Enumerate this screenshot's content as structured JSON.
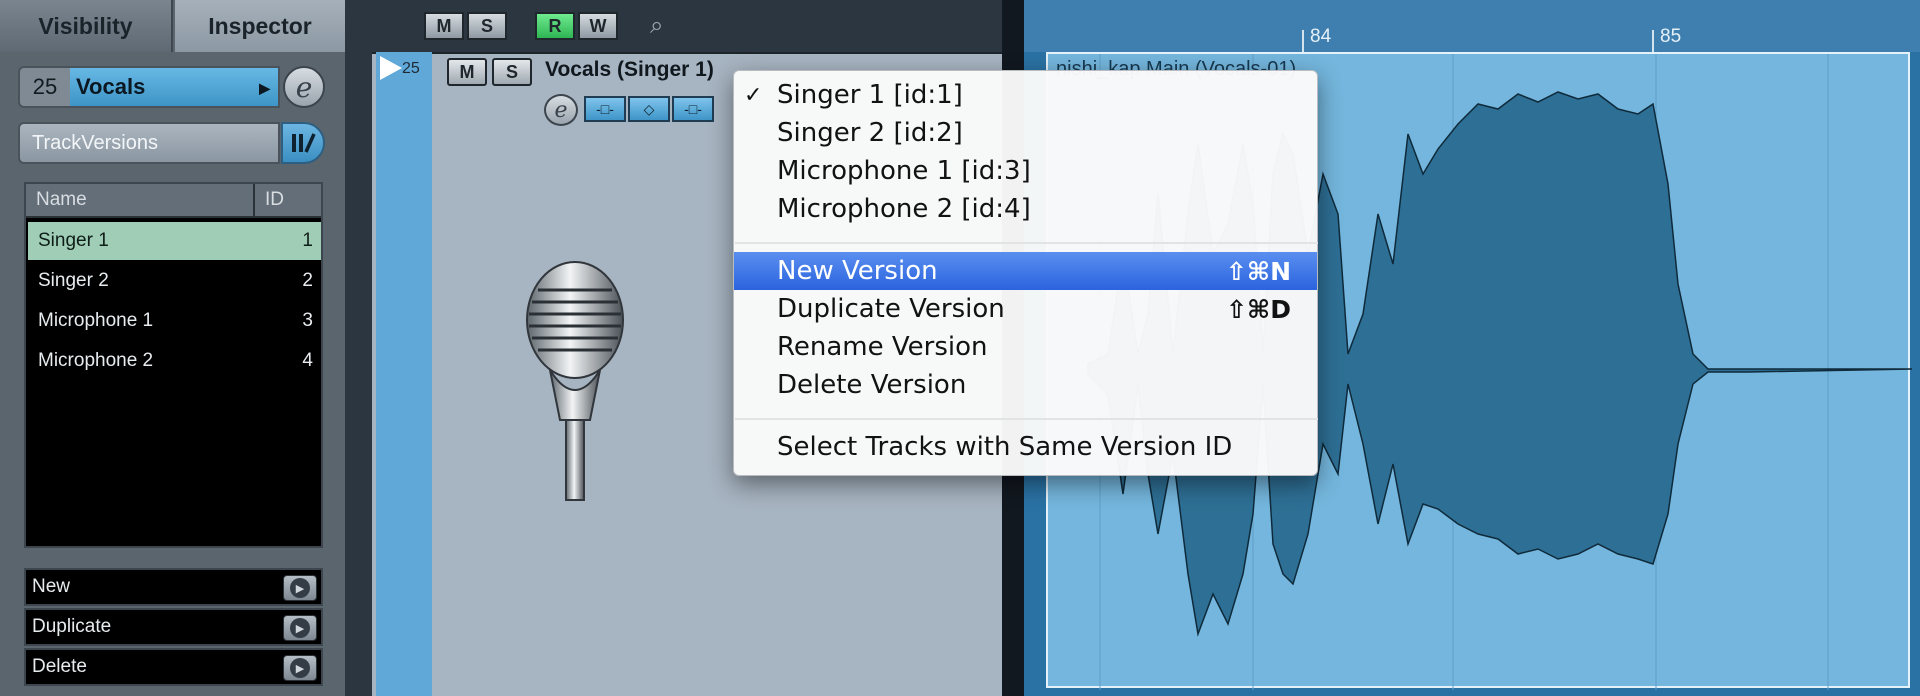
{
  "inspector": {
    "tabs": [
      "Visibility",
      "Inspector"
    ],
    "track_number": "25",
    "track_name": "Vocals",
    "track_versions_label": "TrackVersions",
    "list_headers": {
      "name": "Name",
      "id": "ID"
    },
    "versions": [
      {
        "name": "Singer 1",
        "id": "1"
      },
      {
        "name": "Singer 2",
        "id": "2"
      },
      {
        "name": "Microphone 1",
        "id": "3"
      },
      {
        "name": "Microphone 2",
        "id": "4"
      }
    ],
    "actions": [
      "New",
      "Duplicate",
      "Delete"
    ]
  },
  "toolbar": {
    "buttons": [
      "M",
      "S",
      "R",
      "W"
    ]
  },
  "track": {
    "number": "25",
    "mute": "M",
    "solo": "S",
    "title": "Vocals (Singer 1)"
  },
  "ruler": {
    "bars": [
      "84",
      "85"
    ]
  },
  "event": {
    "label": "nishi_kap Main (Vocals-01)"
  },
  "menu": {
    "version_items": [
      {
        "label": "Singer 1 [id:1]",
        "checked": true
      },
      {
        "label": "Singer 2 [id:2]",
        "checked": false
      },
      {
        "label": "Microphone 1 [id:3]",
        "checked": false
      },
      {
        "label": "Microphone 2 [id:4]",
        "checked": false
      }
    ],
    "checkmark": "✓",
    "new_version": {
      "label": "New Version",
      "shortcut": "⇧⌘N"
    },
    "duplicate_version": {
      "label": "Duplicate Version",
      "shortcut": "⇧⌘D"
    },
    "rename_version": {
      "label": "Rename Version"
    },
    "delete_version": {
      "label": "Delete Version"
    },
    "select_tracks": {
      "label": "Select Tracks with Same Version ID"
    }
  },
  "colors": {
    "selection_blue": "#2b63de",
    "track_color": "#5fa8d8",
    "selected_version_row": "#9fcdb6",
    "event_blue": "#74b6dd"
  },
  "icons": [
    "edit-icon",
    "track-versions-icon",
    "play-icon",
    "search-icon",
    "microphone-image",
    "record-icon",
    "monitor-icon"
  ]
}
